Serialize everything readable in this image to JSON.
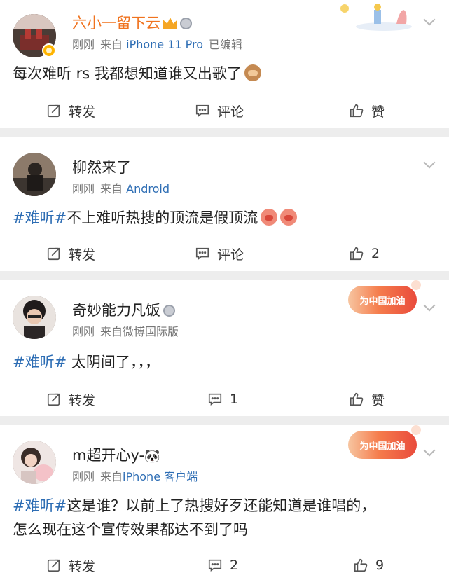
{
  "posts": [
    {
      "username": "六小一留下云",
      "time": "刚刚",
      "from_label": "来自",
      "source": "iPhone 11 Pro",
      "edited": "已编辑",
      "content": "每次难听 rs 我都想知道谁又出歌了",
      "actions": {
        "repost": "转发",
        "comment": "评论",
        "like": "赞"
      }
    },
    {
      "username": "柳然来了",
      "time": "刚刚",
      "from_label": "来自",
      "source": "Android",
      "hashtag": "#难听#",
      "content": "不上难听热搜的顶流是假顶流",
      "actions": {
        "repost": "转发",
        "comment": "评论",
        "like": "2"
      }
    },
    {
      "username": "奇妙能力凡饭",
      "time": "刚刚",
      "from_label": "来自微博国际版",
      "banner": "为中国加油",
      "hashtag": "#难听#",
      "content": " 太阴间了，，，",
      "actions": {
        "repost": "转发",
        "comment": "1",
        "like": "赞"
      }
    },
    {
      "username": "m超开心y-",
      "username_emoji": "🐼",
      "time": "刚刚",
      "from_label": "来自",
      "source": "iPhone 客户端",
      "banner": "为中国加油",
      "hashtag": "#难听#",
      "content_line1": "这是谁？以前上了热搜好歹还能知道是谁唱的，",
      "content_line2": "怎么现在这个宣传效果都达不到了吗",
      "actions": {
        "repost": "转发",
        "comment": "2",
        "like": "9"
      }
    }
  ],
  "colors": {
    "link": "#2d6db4",
    "vip_name": "#f0731f",
    "meta": "#777777",
    "separator": "#ededed"
  },
  "icons": [
    "repost-icon",
    "comment-icon",
    "like-icon",
    "chevron-down-icon",
    "medal-icon",
    "crown-icon",
    "verified-badge-icon"
  ]
}
